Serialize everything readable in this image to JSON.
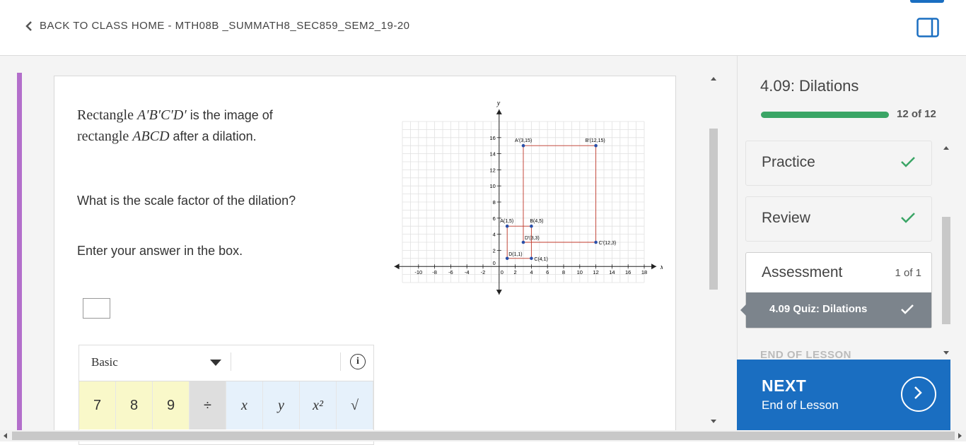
{
  "header": {
    "back_link": "BACK TO CLASS HOME - MTH08B _SUMMATH8_SEC859_SEM2_19-20",
    "icons": [
      "chevron-left-icon",
      "panel-toggle-icon"
    ]
  },
  "question": {
    "line1_word": "Rectangle",
    "line1_math": "A′B′C′D′",
    "line1_rest": "is the image of",
    "line2_word": "rectangle",
    "line2_math": "ABCD",
    "line2_rest": "after a dilation.",
    "prompt": "What is the scale factor of the dilation?",
    "instruction": "Enter your answer in the box.",
    "answer_value": ""
  },
  "keypad": {
    "mode": "Basic",
    "keys": [
      "7",
      "8",
      "9",
      "÷",
      "x",
      "y",
      "x²",
      "√"
    ],
    "info_glyph": "i"
  },
  "chart_data": {
    "type": "scatter",
    "xlabel": "x",
    "ylabel": "y",
    "xlim": [
      -10,
      18
    ],
    "ylim": [
      0,
      16
    ],
    "x_ticks": [
      "-10",
      "-8",
      "-6",
      "-4",
      "-2",
      "0",
      "2",
      "4",
      "6",
      "8",
      "10",
      "12",
      "14",
      "16",
      "18"
    ],
    "y_ticks": [
      "0",
      "2",
      "4",
      "6",
      "8",
      "10",
      "12",
      "14",
      "16"
    ],
    "rect_color": "#c0392b",
    "point_color": "#2a4fa8",
    "points": [
      {
        "label": "A(1,5)",
        "x": 1,
        "y": 5
      },
      {
        "label": "B(4,5)",
        "x": 4,
        "y": 5
      },
      {
        "label": "C(4,1)",
        "x": 4,
        "y": 1
      },
      {
        "label": "D(1,1)",
        "x": 1,
        "y": 1
      },
      {
        "label": "A′(3,15)",
        "x": 3,
        "y": 15
      },
      {
        "label": "B′(12,15)",
        "x": 12,
        "y": 15
      },
      {
        "label": "C′(12,3)",
        "x": 12,
        "y": 3
      },
      {
        "label": "D′(3,3)",
        "x": 3,
        "y": 3
      }
    ],
    "rectangles": [
      {
        "name": "ABCD",
        "vertices": [
          [
            1,
            5
          ],
          [
            4,
            5
          ],
          [
            4,
            1
          ],
          [
            1,
            1
          ]
        ]
      },
      {
        "name": "A′B′C′D′",
        "vertices": [
          [
            3,
            15
          ],
          [
            12,
            15
          ],
          [
            12,
            3
          ],
          [
            3,
            3
          ]
        ]
      }
    ]
  },
  "sidebar": {
    "lesson_title": "4.09: Dilations",
    "progress_label": "12 of 12",
    "progress_fraction": 1.0,
    "items": [
      {
        "label": "Practice",
        "done": true
      },
      {
        "label": "Review",
        "done": true
      }
    ],
    "assessment": {
      "label": "Assessment",
      "count": "1 of 1",
      "quiz": "4.09 Quiz: Dilations"
    },
    "end_label": "END OF LESSON"
  },
  "next_button": {
    "label": "NEXT",
    "sublabel": "End of Lesson"
  },
  "colors": {
    "accent_blue": "#1a6ec1",
    "progress_green": "#3aa565",
    "purple": "#b36fcb",
    "check_green": "#3aa565"
  }
}
